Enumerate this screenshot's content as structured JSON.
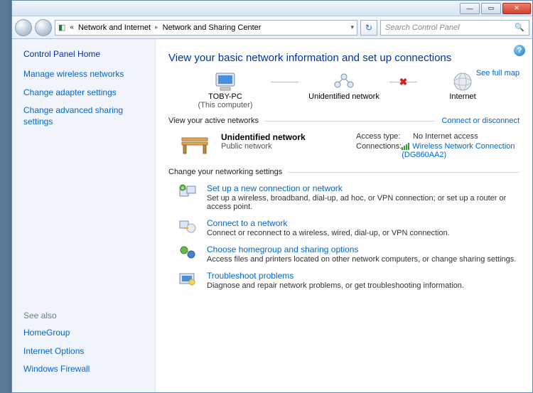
{
  "titlebar": {},
  "navbar": {
    "crumb1": "Network and Internet",
    "crumb2": "Network and Sharing Center",
    "search_placeholder": "Search Control Panel"
  },
  "sidebar": {
    "home": "Control Panel Home",
    "links": [
      "Manage wireless networks",
      "Change adapter settings",
      "Change advanced sharing settings"
    ],
    "seealso_label": "See also",
    "seealso": [
      "HomeGroup",
      "Internet Options",
      "Windows Firewall"
    ]
  },
  "main": {
    "title": "View your basic network information and set up connections",
    "full_map": "See full map",
    "map": {
      "node1": "TOBY-PC",
      "node1_sub": "(This computer)",
      "node2": "Unidentified network",
      "node3": "Internet"
    },
    "active_hdr": "View your active networks",
    "connect_link": "Connect or disconnect",
    "network": {
      "name": "Unidentified network",
      "type": "Public network",
      "access_label": "Access type:",
      "access_value": "No Internet access",
      "conn_label": "Connections:",
      "conn_value": "Wireless Network Connection (DG860AA2)"
    },
    "change_hdr": "Change your networking settings",
    "settings": [
      {
        "title": "Set up a new connection or network",
        "desc": "Set up a wireless, broadband, dial-up, ad hoc, or VPN connection; or set up a router or access point."
      },
      {
        "title": "Connect to a network",
        "desc": "Connect or reconnect to a wireless, wired, dial-up, or VPN connection."
      },
      {
        "title": "Choose homegroup and sharing options",
        "desc": "Access files and printers located on other network computers, or change sharing settings."
      },
      {
        "title": "Troubleshoot problems",
        "desc": "Diagnose and repair network problems, or get troubleshooting information."
      }
    ]
  }
}
